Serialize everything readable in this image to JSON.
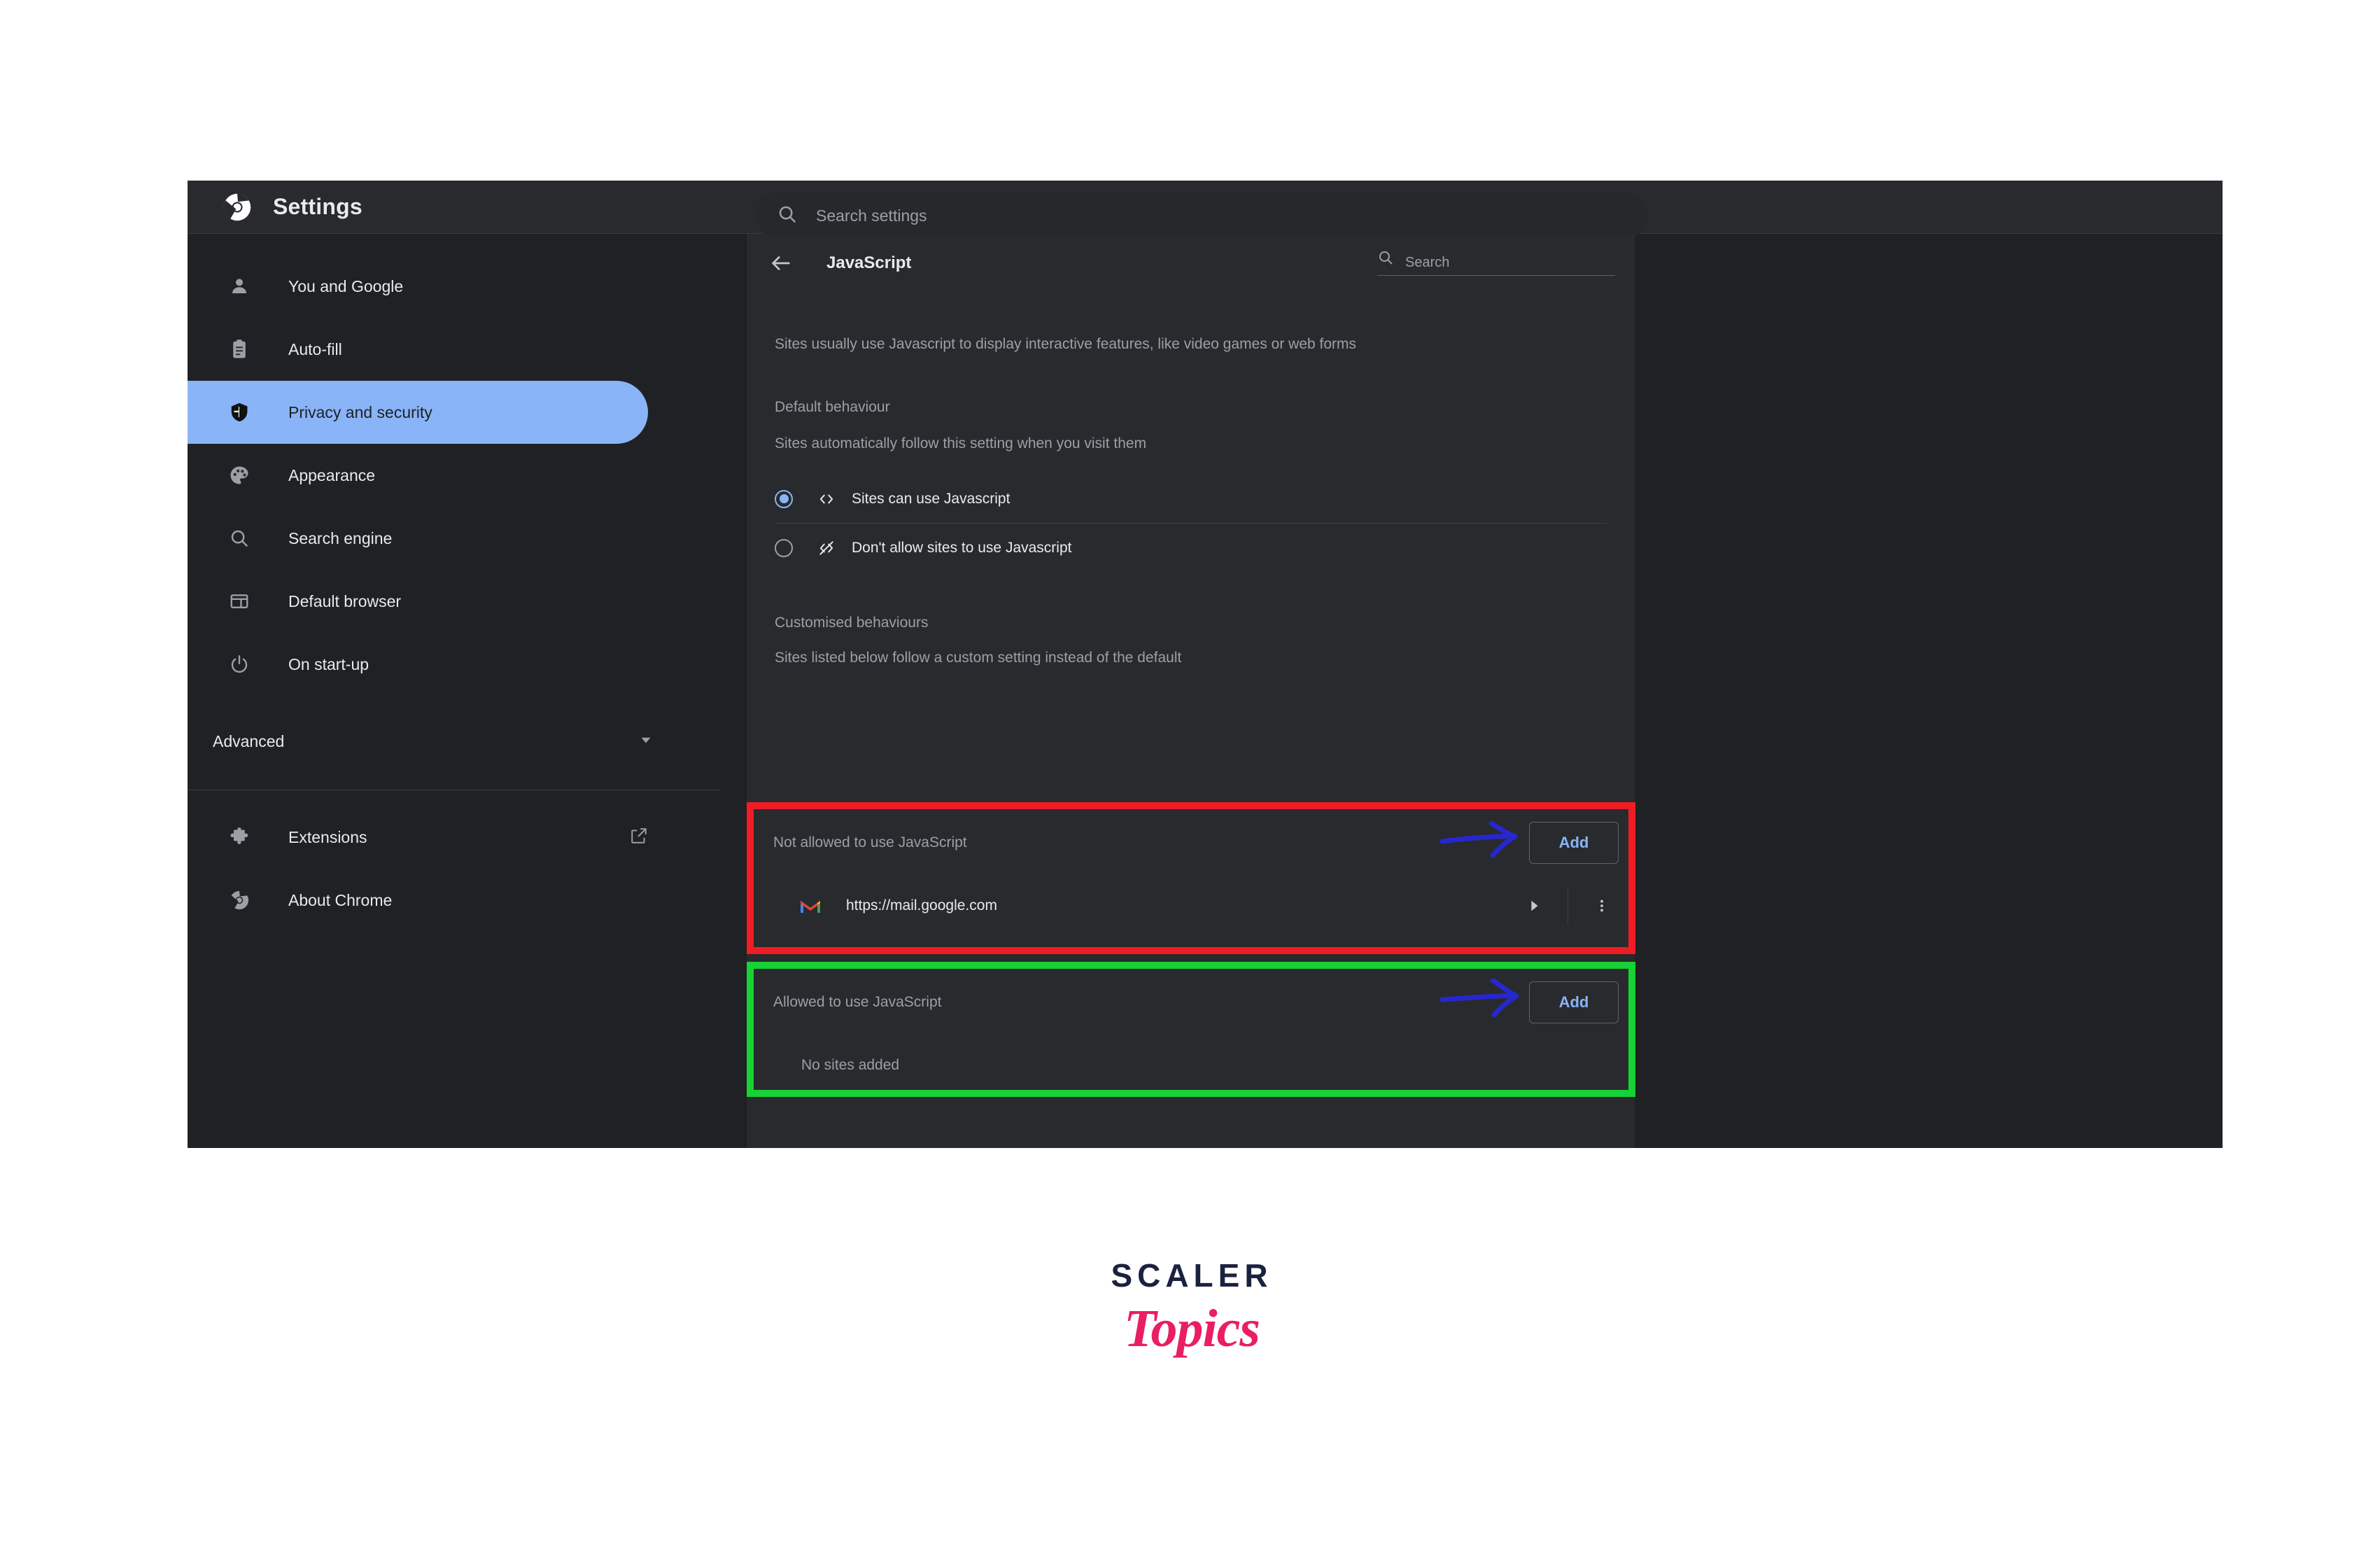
{
  "window": {
    "title": "Settings",
    "chrome_logo_icon": "chrome-logo-icon"
  },
  "top_search": {
    "placeholder": "Search settings",
    "value": "",
    "icon": "search-icon"
  },
  "sidebar": {
    "items": [
      {
        "label": "You and Google",
        "icon": "person-icon",
        "active": false
      },
      {
        "label": "Auto-fill",
        "icon": "clipboard-icon",
        "active": false
      },
      {
        "label": "Privacy and security",
        "icon": "shield-icon",
        "active": true
      },
      {
        "label": "Appearance",
        "icon": "palette-icon",
        "active": false
      },
      {
        "label": "Search engine",
        "icon": "search-icon",
        "active": false
      },
      {
        "label": "Default browser",
        "icon": "browser-window-icon",
        "active": false
      },
      {
        "label": "On start-up",
        "icon": "power-icon",
        "active": false
      }
    ],
    "advanced": {
      "label": "Advanced",
      "icon": "chevron-down-icon"
    },
    "footer_items": [
      {
        "label": "Extensions",
        "icon": "puzzle-icon",
        "trailing_icon": "external-link-icon"
      },
      {
        "label": "About Chrome",
        "icon": "chrome-logo-icon"
      }
    ]
  },
  "content": {
    "back_icon": "back-arrow-icon",
    "title": "JavaScript",
    "search": {
      "placeholder": "Search",
      "value": "",
      "icon": "search-icon"
    },
    "intro": "Sites usually use Javascript to display interactive features, like video games or web forms",
    "default_behaviour": {
      "heading": "Default behaviour",
      "description": "Sites automatically follow this setting when you visit them",
      "options": [
        {
          "label": "Sites can use Javascript",
          "icon": "code-brackets-icon",
          "selected": true
        },
        {
          "label": "Don't allow sites to use Javascript",
          "icon": "code-brackets-slashed-icon",
          "selected": false
        }
      ]
    },
    "customised": {
      "heading": "Customised behaviours",
      "description": "Sites listed below follow a custom setting instead of the default"
    },
    "not_allowed_card": {
      "label": "Not allowed to use JavaScript",
      "add_label": "Add",
      "sites": [
        {
          "url": "https://mail.google.com",
          "favicon": "gmail-icon",
          "expand_icon": "triangle-right-icon",
          "more_icon": "three-dot-menu-icon"
        }
      ]
    },
    "allowed_card": {
      "label": "Allowed to use JavaScript",
      "add_label": "Add",
      "empty_text": "No sites added"
    }
  },
  "annotations": {
    "red_highlight_color": "#f01c24",
    "green_highlight_color": "#17d235",
    "arrow_color": "#2727cf",
    "arrows": [
      {
        "name": "arrow-to-add-not-allowed"
      },
      {
        "name": "arrow-to-add-allowed"
      }
    ]
  },
  "watermark": {
    "primary": "SCALER",
    "secondary": "Topics",
    "primary_color": "#1b2240",
    "secondary_color": "#e91e63"
  },
  "theme": {
    "window_bg": "#202124",
    "topbar_bg": "#292a2d",
    "panel_bg": "#292a2d",
    "accent": "#8ab4f8",
    "text_primary": "#e8eaed",
    "text_secondary": "#9aa0a6"
  }
}
